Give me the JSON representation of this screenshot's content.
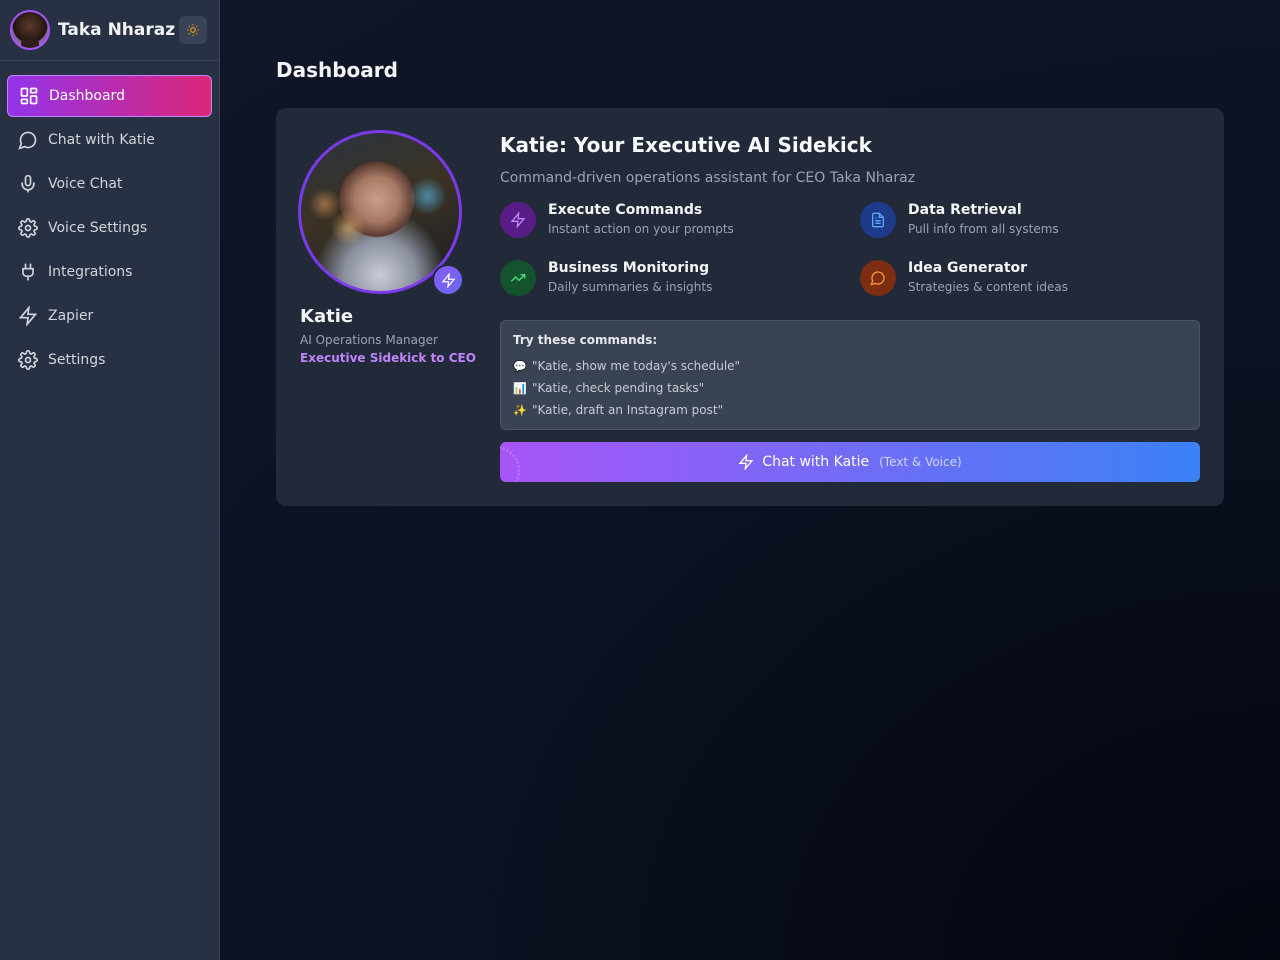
{
  "user": {
    "name": "Taka Nharaz"
  },
  "sidebar": {
    "items": [
      {
        "label": "Dashboard",
        "icon": "dashboard-icon"
      },
      {
        "label": "Chat with Katie",
        "icon": "chat-bubble-icon"
      },
      {
        "label": "Voice Chat",
        "icon": "microphone-icon"
      },
      {
        "label": "Voice Settings",
        "icon": "gear-icon"
      },
      {
        "label": "Integrations",
        "icon": "plug-icon"
      },
      {
        "label": "Zapier",
        "icon": "lightning-icon"
      },
      {
        "label": "Settings",
        "icon": "gear-icon"
      }
    ],
    "active": "Dashboard"
  },
  "main": {
    "title": "Dashboard",
    "agent": {
      "name": "Katie",
      "role": "AI Operations Manager",
      "tagline": "Executive Sidekick to CEO"
    },
    "headline": "Katie: Your Executive AI Sidekick",
    "subhead": "Command-driven operations assistant for CEO Taka Nharaz",
    "features": [
      {
        "title": "Execute Commands",
        "desc": "Instant action on your prompts",
        "icon": "lightning-icon",
        "color": "#6b21a8"
      },
      {
        "title": "Data Retrieval",
        "desc": "Pull info from all systems",
        "icon": "document-icon",
        "color": "#1e3a8a"
      },
      {
        "title": "Business Monitoring",
        "desc": "Daily summaries & insights",
        "icon": "trending-up-icon",
        "color": "#14532d"
      },
      {
        "title": "Idea Generator",
        "desc": "Strategies & content ideas",
        "icon": "chat-bubble-icon",
        "color": "#7c2d12"
      }
    ],
    "commands": {
      "title": "Try these commands:",
      "items": [
        {
          "emoji": "💬",
          "text": "\"Katie, show me today's schedule\""
        },
        {
          "emoji": "📊",
          "text": "\"Katie, check pending tasks\""
        },
        {
          "emoji": "✨",
          "text": "\"Katie, draft an Instagram post\""
        }
      ]
    },
    "cta": {
      "label": "Chat with Katie",
      "sublabel": "(Text & Voice)"
    }
  },
  "colors": {
    "accent_purple": "#a855f7",
    "accent_pink": "#db2777",
    "accent_blue": "#3b82f6",
    "sidebar_bg": "#283143",
    "card_bg": "#222a3a"
  }
}
